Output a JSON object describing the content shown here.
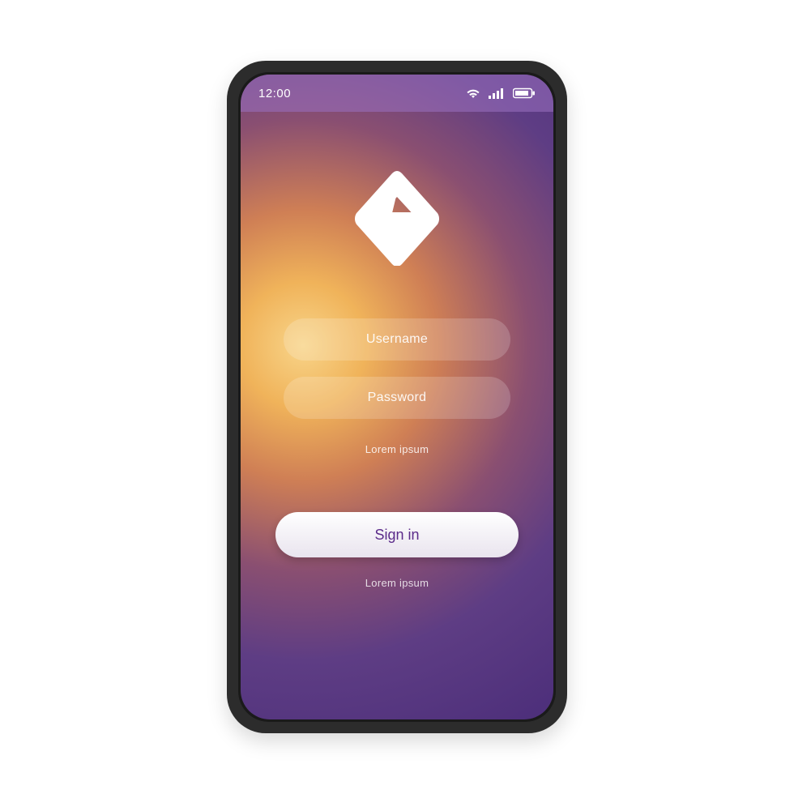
{
  "statusbar": {
    "time": "12:00",
    "icons": {
      "wifi": "wifi-icon",
      "signal": "signal-icon",
      "battery": "battery-icon"
    }
  },
  "logo": {
    "name": "app-logo-g"
  },
  "form": {
    "username_placeholder": "Username",
    "password_placeholder": "Password",
    "forgot_text": "Lorem ipsum",
    "signin_label": "Sign in",
    "footer_text": "Lorem ipsum"
  },
  "colors": {
    "accent": "#5b2b8a",
    "gradient_warm": "#f0b35a",
    "gradient_purple": "#4c2e7a"
  }
}
